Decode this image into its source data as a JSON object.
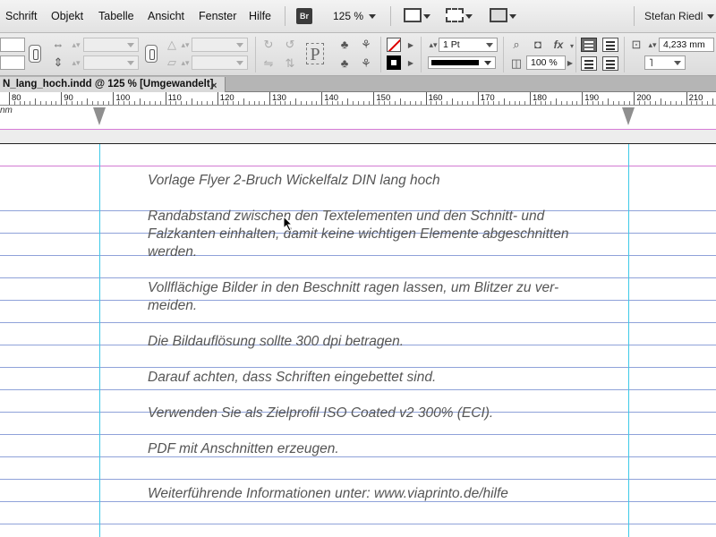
{
  "menubar": {
    "items": [
      "Schrift",
      "Objekt",
      "Tabelle",
      "Ansicht",
      "Fenster",
      "Hilfe"
    ],
    "bridge_label": "Br",
    "zoom": "125 %",
    "user": "Stefan Riedl"
  },
  "control": {
    "stroke_weight": "1 Pt",
    "opacity": "100 %",
    "gutter": "4,233 mm"
  },
  "doc_tab": {
    "title": "N_lang_hoch.indd @ 125 % [Umgewandelt]",
    "close": "×"
  },
  "ruler": {
    "labels": [
      "80",
      "90",
      "100",
      "110",
      "120",
      "130",
      "140",
      "150",
      "160",
      "170",
      "180",
      "190",
      "200",
      "210"
    ],
    "unit": "nm"
  },
  "document": {
    "lines": [
      "Vorlage Flyer 2-Bruch Wickelfalz  DIN lang hoch",
      "Randabstand zwischen den Textelementen und den Schnitt- und",
      "Falzkanten einhalten, damit keine wichtigen Elemente abgeschnitten",
      "werden.",
      "Vollflächige Bilder in den Beschnitt ragen lassen, um Blitzer zu ver-",
      "meiden.",
      "Die Bildauflösung sollte 300 dpi betragen.",
      "Darauf achten, dass Schriften eingebettet sind.",
      "Verwenden Sie als Zielprofil ISO Coated v2 300% (ECI).",
      "PDF mit Anschnitten erzeugen.",
      "Weiterführende Informationen unter: www.viaprinto.de/hilfe"
    ]
  },
  "colors": {
    "baseline_grid": "#8fa2d9",
    "column_guide": "#3ec9e8",
    "margin_guide": "#d27bd2",
    "text": "#555555"
  }
}
